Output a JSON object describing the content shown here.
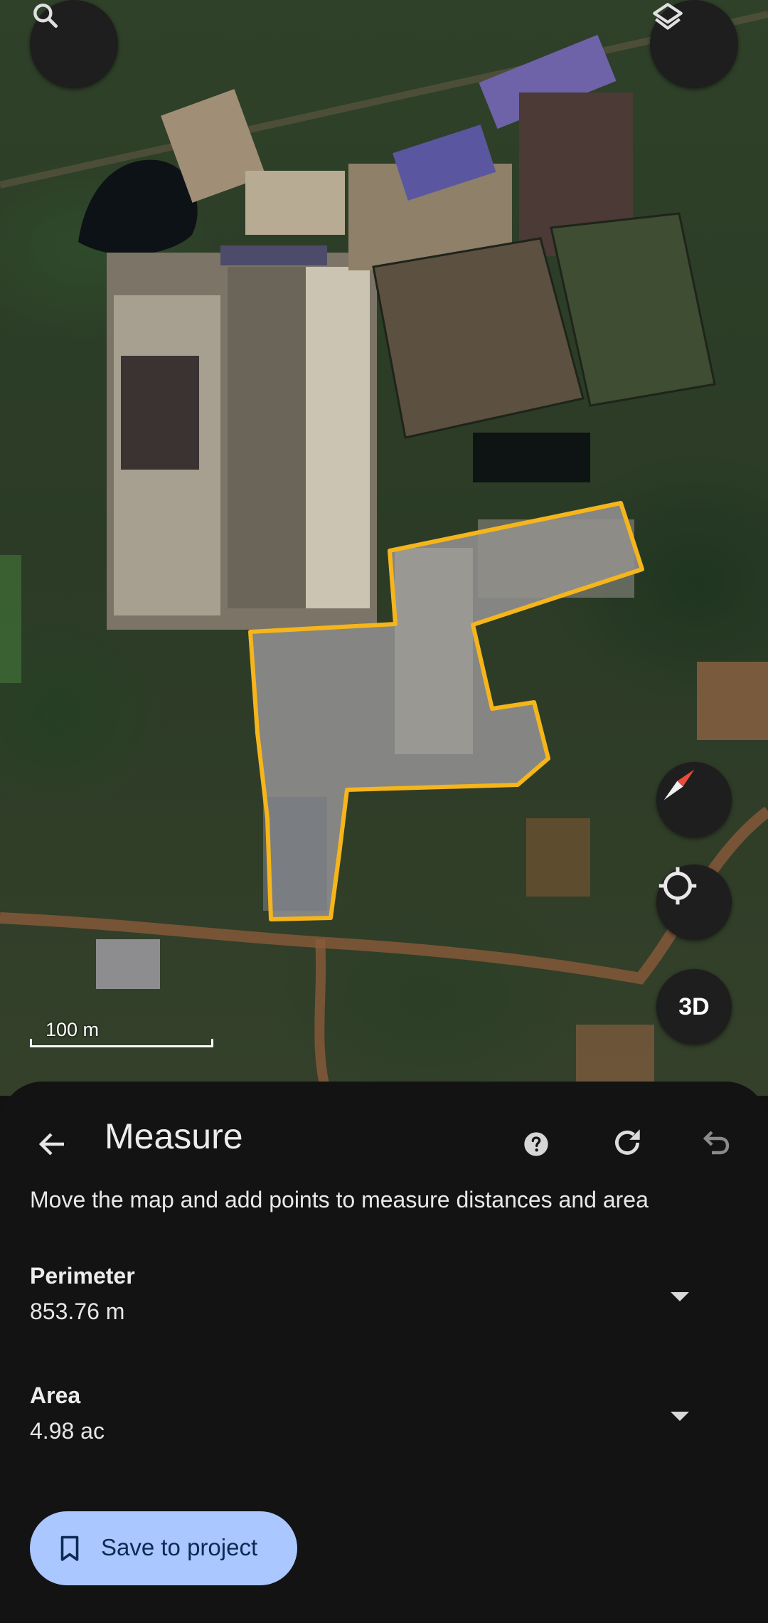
{
  "map": {
    "scale_label": "100 m",
    "compass_icon": "compass-icon",
    "search_icon": "search-icon",
    "layers_icon": "layers-icon",
    "locate_icon": "my-location-icon",
    "three_d_label": "3D",
    "measure_outline_color": "#f5b51b"
  },
  "sheet": {
    "title": "Measure",
    "hint": "Move the map and add points to measure distances and area",
    "perimeter": {
      "label": "Perimeter",
      "value": "853.76 m"
    },
    "area": {
      "label": "Area",
      "value": "4.98 ac"
    },
    "save_label": "Save to project",
    "icons": {
      "back": "arrow-back-icon",
      "help": "help-icon",
      "reset": "refresh-icon",
      "undo": "undo-icon",
      "dropdown": "chevron-down-icon",
      "bookmark": "bookmark-icon"
    }
  }
}
